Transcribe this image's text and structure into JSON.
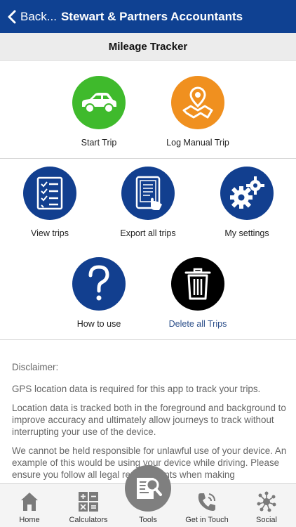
{
  "header": {
    "back_label": "Back...",
    "title": "Stewart & Partners Accountants"
  },
  "subheader": {
    "title": "Mileage Tracker"
  },
  "tiles": {
    "start_trip": "Start Trip",
    "log_manual_trip": "Log Manual Trip",
    "view_trips": "View trips",
    "export_all_trips": "Export all trips",
    "my_settings": "My settings",
    "how_to_use": "How to use",
    "delete_all_trips": "Delete all Trips"
  },
  "disclaimer": {
    "title": "Disclaimer:",
    "p1": "GPS location data is required for this app to track your trips.",
    "p2": "Location data is tracked both in the foreground and background to improve accuracy and ultimately allow journeys to track without interrupting your use of the device.",
    "p3": "We cannot be held responsible for unlawful use of your device. An example of this would be using your device while driving. Please ensure you follow all legal requirements when making"
  },
  "tabbar": {
    "home": "Home",
    "calculators": "Calculators",
    "tools": "Tools",
    "get_in_touch": "Get in Touch",
    "social": "Social"
  },
  "colors": {
    "header": "#0f4192",
    "start_trip": "#3fba2c",
    "log_manual_trip": "#f0901f",
    "navy_icon": "#123f8f",
    "delete_icon": "#000000"
  }
}
